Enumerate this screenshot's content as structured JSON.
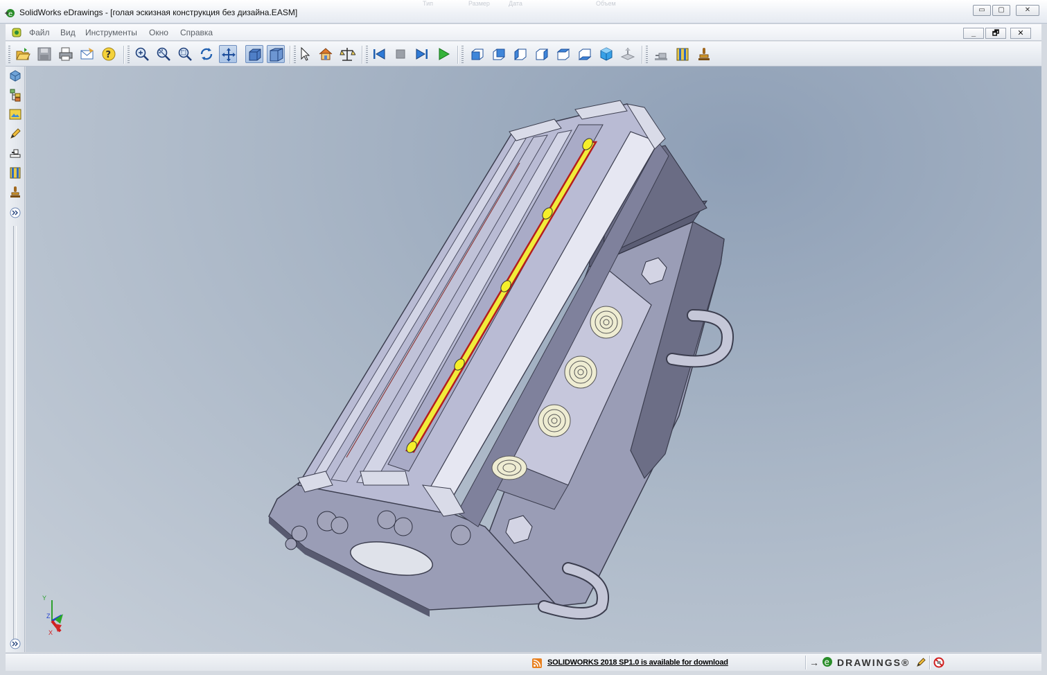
{
  "window": {
    "title": "SolidWorks eDrawings - [голая эскизная конструкция без дизайна.EASM]",
    "background_fragments": [
      "Тип",
      "Размер",
      "Дата",
      "Объем"
    ],
    "controls": {
      "minimize": "▭",
      "maximize": "▢",
      "close": "✕"
    }
  },
  "menu": {
    "items": [
      "Файл",
      "Вид",
      "Инструменты",
      "Окно",
      "Справка"
    ],
    "mdi_controls": {
      "minimize": "_",
      "restore": "🗗",
      "close": "✕"
    }
  },
  "toolbar": {
    "groups": [
      [
        "open-icon",
        "save-icon",
        "print-icon",
        "send-mail-icon",
        "help-icon"
      ],
      [
        "zoom-to-fit-icon",
        "zoom-in-out-icon",
        "zoom-to-area-icon",
        "rotate-icon",
        "pan-icon",
        "shaded-icon",
        "perspective-icon"
      ],
      [
        "select-icon",
        "home-icon",
        "measure-icon"
      ],
      [
        "first-frame-icon",
        "stop-icon",
        "next-frame-icon",
        "play-icon"
      ],
      [
        "view-front-icon",
        "view-back-icon",
        "view-left-icon",
        "view-right-icon",
        "view-top-icon",
        "view-bottom-icon",
        "view-isometric-icon",
        "section-icon"
      ],
      [
        "stamp-icon",
        "move-component-icon",
        "markup-icon"
      ]
    ],
    "pressed": [
      "pan-icon",
      "shaded-icon",
      "perspective-icon"
    ]
  },
  "left_toolbar": {
    "icons": [
      "components-icon",
      "configurations-icon",
      "sheets-icon",
      "markup-pencil-icon",
      "stamp-tool-icon",
      "explode-icon",
      "measure-tool-icon",
      "expand-icon"
    ],
    "bottom_icon": "expand-icon"
  },
  "triad": {
    "x_label": "X",
    "y_label": "Y",
    "z_label": "Z"
  },
  "status": {
    "news": "SOLIDWORKS 2018 SP1.0 is available for download",
    "brand_arrow": "→",
    "brand_text": "DRAWINGS®",
    "icons": [
      "pencil-status-icon",
      "no-sign-icon"
    ]
  },
  "colors": {
    "viewport_top": "#8e9fb6",
    "viewport_bottom": "#c7cfd9",
    "model_light": "#e4e6f1",
    "model_mid": "#b9bbd4",
    "model_dark": "#585a70",
    "heater_yellow": "#f1ec3a",
    "heater_red": "#b31e1e"
  }
}
